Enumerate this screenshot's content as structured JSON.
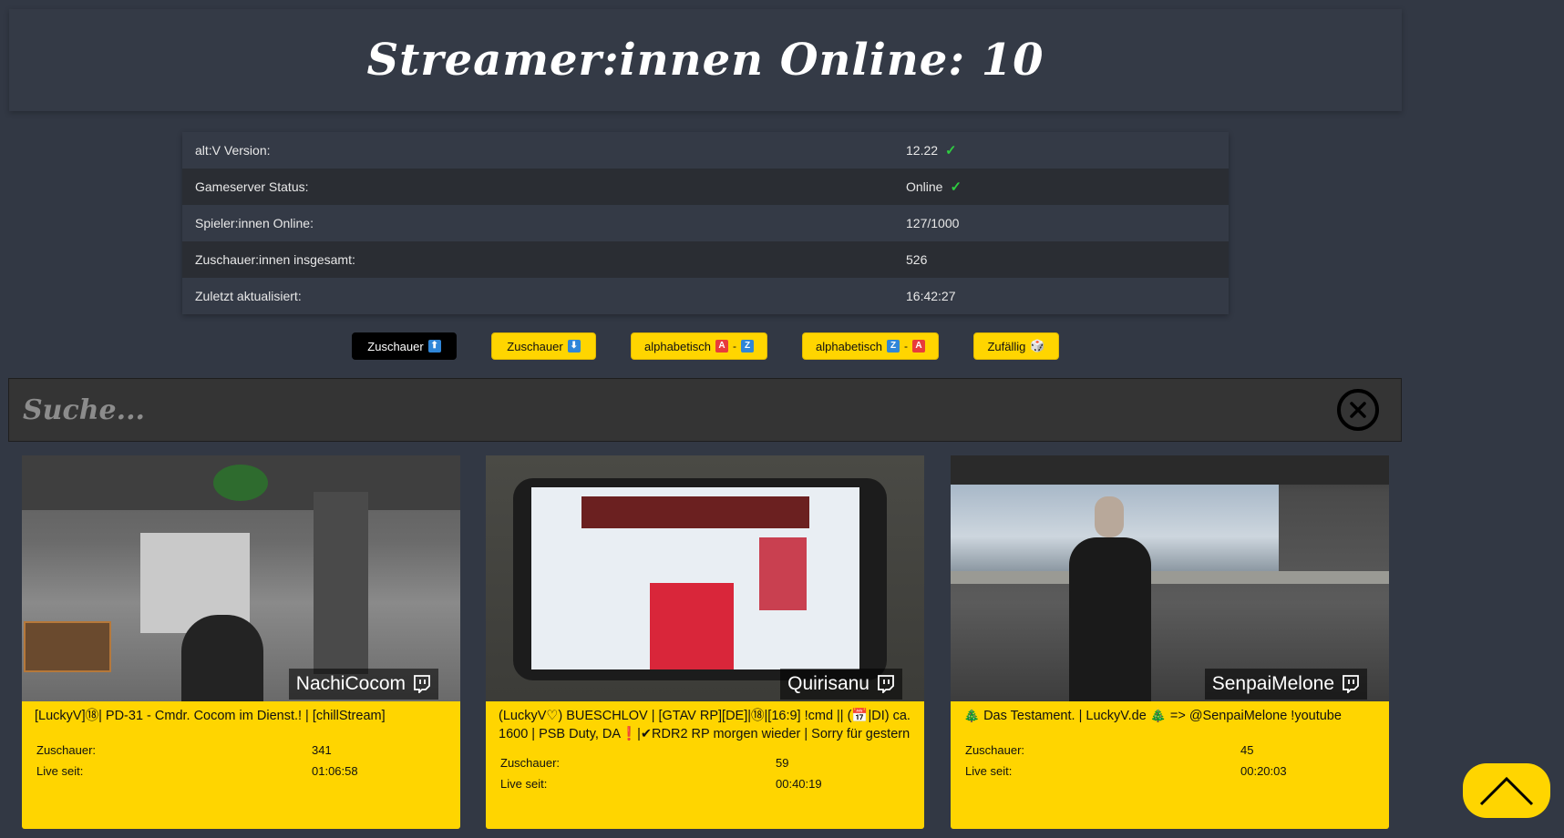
{
  "header": {
    "title": "Streamer:innen Online: 10"
  },
  "info": [
    {
      "key": "alt:V Version:",
      "value": "12.22",
      "ok": true
    },
    {
      "key": "Gameserver Status:",
      "value": "Online",
      "ok": true
    },
    {
      "key": "Spieler:innen Online:",
      "value": "127/1000",
      "ok": false
    },
    {
      "key": "Zuschauer:innen insgesamt:",
      "value": "526",
      "ok": false
    },
    {
      "key": "Zuletzt aktualisiert:",
      "value": "16:42:27",
      "ok": false
    }
  ],
  "sort": [
    {
      "label": "Zuschauer",
      "icon1": "⬆",
      "icon1_color": "blue",
      "active": true
    },
    {
      "label": "Zuschauer",
      "icon1": "⬇",
      "icon1_color": "blue",
      "active": false
    },
    {
      "label": "alphabetisch",
      "icon1": "A",
      "icon1_color": "red",
      "dash": "-",
      "icon2": "Z",
      "icon2_color": "blue",
      "active": false
    },
    {
      "label": "alphabetisch",
      "icon1": "Z",
      "icon1_color": "blue",
      "dash": "-",
      "icon2": "A",
      "icon2_color": "red",
      "active": false
    },
    {
      "label": "Zufällig",
      "icon1": "🎲",
      "icon1_color": "none",
      "active": false
    }
  ],
  "search": {
    "placeholder": "Suche..."
  },
  "cards": [
    {
      "name": "NachiCocom",
      "title": "[LuckyV]⑱| PD-31 - Cmdr. Cocom im Dienst.! | [chillStream]",
      "viewers_label": "Zuschauer:",
      "viewers": "341",
      "live_label": "Live seit:",
      "live": "01:06:58"
    },
    {
      "name": "Quirisanu",
      "title": "(LuckyV♡) BUESCHLOV | [GTAV RP][DE]|⑱|[16:9] !cmd || (📅|DI) ca. 1600 | PSB Duty, DA❗|✔RDR2 RP morgen wieder | Sorry für gestern",
      "viewers_label": "Zuschauer:",
      "viewers": "59",
      "live_label": "Live seit:",
      "live": "00:40:19"
    },
    {
      "name": "SenpaiMelone",
      "title": "🎄 Das Testament. | LuckyV.de 🎄 => @SenpaiMelone !youtube",
      "viewers_label": "Zuschauer:",
      "viewers": "45",
      "live_label": "Live seit:",
      "live": "00:20:03"
    }
  ],
  "icons": {
    "twitch": "twitch-icon",
    "clear": "close-circle-icon",
    "up": "chevron-up-icon"
  },
  "colors": {
    "accent": "#ffd500",
    "bg": "#323844",
    "ok": "#2ecc40"
  }
}
